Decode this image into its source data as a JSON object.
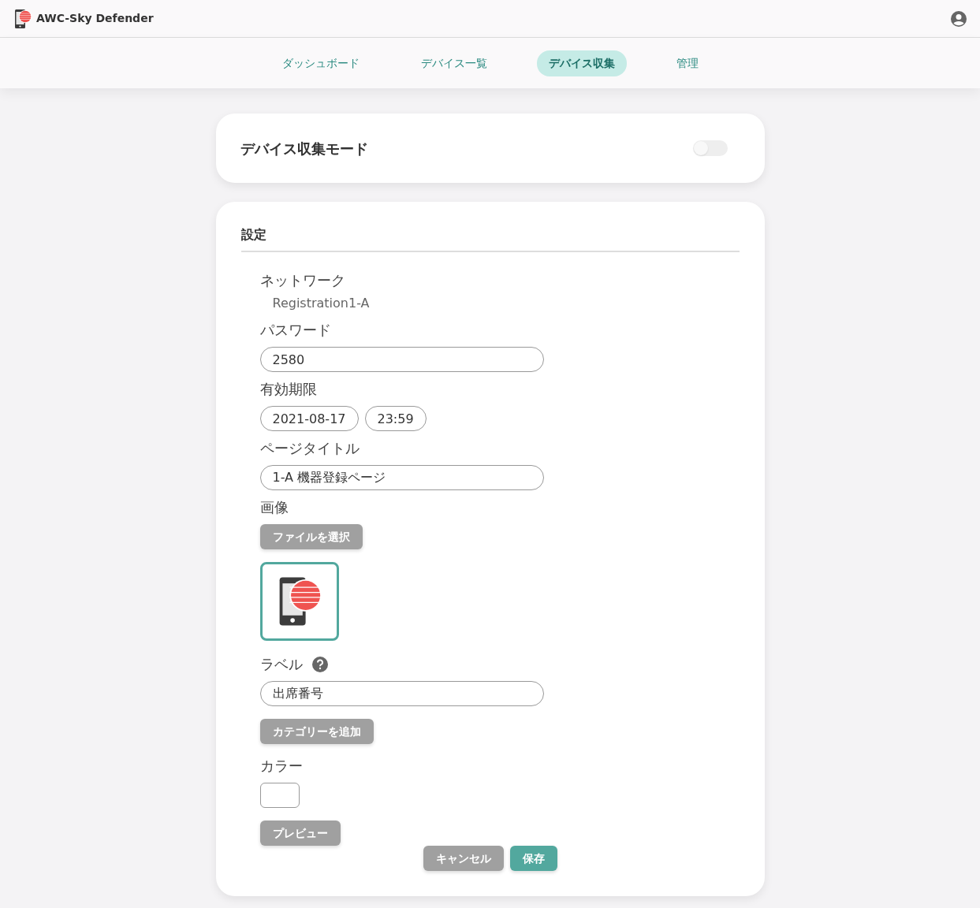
{
  "app": {
    "title": "AWC-Sky Defender"
  },
  "tabs": [
    {
      "label": "ダッシュボード",
      "selected": false
    },
    {
      "label": "デバイス一覧",
      "selected": false
    },
    {
      "label": "デバイス収集",
      "selected": true
    },
    {
      "label": "管理",
      "selected": false
    }
  ],
  "collection_mode": {
    "title": "デバイス収集モード",
    "on": false
  },
  "settings": {
    "title": "設定",
    "network": {
      "label": "ネットワーク",
      "value": "Registration1-A"
    },
    "password": {
      "label": "パスワード",
      "value": "2580"
    },
    "expiry": {
      "label": "有効期限",
      "date": "2021-08-17",
      "time": "23:59"
    },
    "page_title": {
      "label": "ページタイトル",
      "value": "1-A 機器登録ページ"
    },
    "image": {
      "label": "画像",
      "button": "ファイルを選択"
    },
    "label_field": {
      "label": "ラベル",
      "value": "出席番号"
    },
    "add_category_button": "カテゴリーを追加",
    "color": {
      "label": "カラー"
    },
    "preview_button": "プレビュー"
  },
  "buttons": [
    {
      "label": "キャンセル",
      "kind": "secondary"
    },
    {
      "label": "保存",
      "kind": "primary"
    }
  ]
}
